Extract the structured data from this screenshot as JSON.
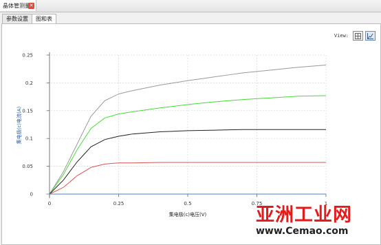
{
  "window": {
    "doc_tab_label": "晶体管测量",
    "close_glyph": "✕"
  },
  "subtabs": [
    {
      "label": "参数设置"
    },
    {
      "label": "图和表"
    }
  ],
  "view": {
    "label": "View:",
    "grid_icon": "grid-icon",
    "chart_icon": "chart-icon"
  },
  "chart_data": {
    "type": "line",
    "xlabel": "集电极(c)电压(V)",
    "ylabel": "集电极(c)电流(A)",
    "xlim": [
      0,
      1.0
    ],
    "ylim": [
      0,
      0.25
    ],
    "xticks": [
      "0",
      "0.25",
      "0.5",
      "0.75",
      "1"
    ],
    "yticks": [
      "0",
      "0.05",
      "0.1",
      "0.15",
      "0.2",
      "0.25"
    ],
    "grid": true,
    "series": [
      {
        "color": "#999999",
        "x": [
          0,
          0.05,
          0.1,
          0.15,
          0.2,
          0.25,
          0.3,
          0.4,
          0.5,
          0.6,
          0.7,
          0.8,
          0.9,
          1.0
        ],
        "y": [
          0,
          0.04,
          0.09,
          0.14,
          0.168,
          0.18,
          0.186,
          0.196,
          0.204,
          0.211,
          0.218,
          0.223,
          0.228,
          0.232
        ]
      },
      {
        "color": "#44dd33",
        "x": [
          0,
          0.05,
          0.1,
          0.15,
          0.2,
          0.25,
          0.3,
          0.4,
          0.5,
          0.6,
          0.7,
          0.8,
          0.9,
          1.0
        ],
        "y": [
          0,
          0.035,
          0.08,
          0.118,
          0.137,
          0.144,
          0.148,
          0.155,
          0.161,
          0.166,
          0.17,
          0.173,
          0.176,
          0.177
        ]
      },
      {
        "color": "#222222",
        "x": [
          0,
          0.05,
          0.1,
          0.15,
          0.2,
          0.25,
          0.3,
          0.4,
          0.5,
          0.6,
          0.7,
          0.8,
          0.9,
          1.0
        ],
        "y": [
          0,
          0.025,
          0.058,
          0.085,
          0.098,
          0.104,
          0.108,
          0.112,
          0.114,
          0.115,
          0.116,
          0.116,
          0.116,
          0.116
        ]
      },
      {
        "color": "#d9534f",
        "x": [
          0,
          0.05,
          0.1,
          0.15,
          0.2,
          0.25,
          0.3,
          0.4,
          0.5,
          0.6,
          0.7,
          0.8,
          0.9,
          1.0
        ],
        "y": [
          0,
          0.012,
          0.033,
          0.048,
          0.054,
          0.056,
          0.056,
          0.057,
          0.057,
          0.057,
          0.057,
          0.057,
          0.057,
          0.057
        ]
      },
      {
        "color": "#4a7fd4",
        "x": [
          0,
          1.0
        ],
        "y": [
          0,
          0
        ]
      }
    ]
  },
  "watermark": {
    "line1": "亚洲工业网",
    "line2": "www.Cemao.com"
  }
}
